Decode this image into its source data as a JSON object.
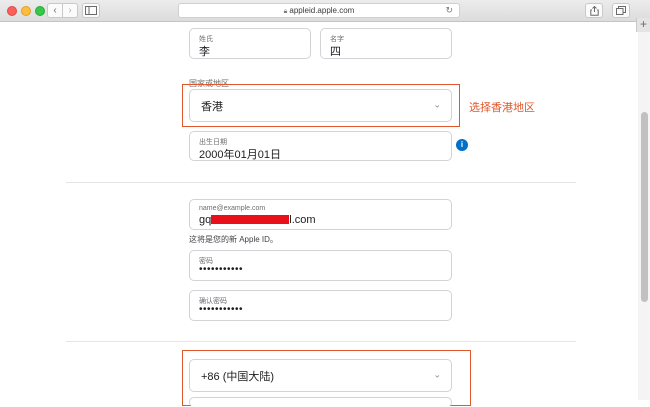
{
  "browser": {
    "url": "appleid.apple.com",
    "back_glyph": "‹",
    "forward_glyph": "›",
    "reload_glyph": "↻",
    "new_tab_glyph": "+"
  },
  "form": {
    "last_name": {
      "label": "姓氏",
      "value": "李"
    },
    "first_name": {
      "label": "名字",
      "value": "四"
    },
    "region": {
      "section_label": "国家或地区",
      "value": "香港"
    },
    "birthday": {
      "label": "出生日期",
      "value": "2000年01月01日"
    },
    "email": {
      "label": "name@example.com",
      "value_prefix": "gq",
      "value_suffix": "l.com",
      "hint": "这将是您的新 Apple ID。"
    },
    "password": {
      "label": "密码",
      "value": "•••••••••••"
    },
    "confirm_password": {
      "label": "确认密码",
      "value": "•••••••••••"
    },
    "phone_country": {
      "value": "+86 (中国大陆)"
    }
  },
  "annotation": {
    "text": "选择香港地区",
    "color": "#e0572c"
  },
  "colors": {
    "accent_blue": "#0070c9",
    "annotation_red": "#e0572c",
    "redaction_red": "#e8101a"
  },
  "icons": {
    "info": "i",
    "chevron": "⌄"
  }
}
